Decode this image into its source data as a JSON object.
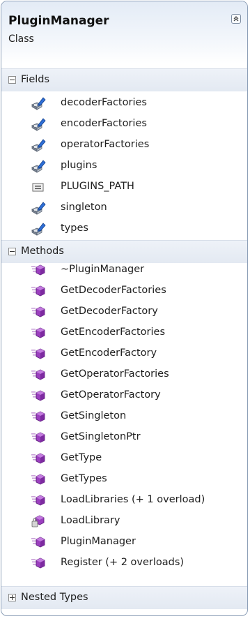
{
  "class": {
    "name": "PluginManager",
    "stereotype": "Class"
  },
  "sections": {
    "fields": {
      "label": "Fields",
      "items": [
        {
          "name": "decoderFactories",
          "icon": "field-icon"
        },
        {
          "name": "encoderFactories",
          "icon": "field-icon"
        },
        {
          "name": "operatorFactories",
          "icon": "field-icon"
        },
        {
          "name": "plugins",
          "icon": "field-icon"
        },
        {
          "name": "PLUGINS_PATH",
          "icon": "constant-icon"
        },
        {
          "name": "singleton",
          "icon": "field-icon"
        },
        {
          "name": "types",
          "icon": "field-icon"
        }
      ]
    },
    "methods": {
      "label": "Methods",
      "items": [
        {
          "name": "~PluginManager",
          "icon": "method-icon"
        },
        {
          "name": "GetDecoderFactories",
          "icon": "method-icon"
        },
        {
          "name": "GetDecoderFactory",
          "icon": "method-icon"
        },
        {
          "name": "GetEncoderFactories",
          "icon": "method-icon"
        },
        {
          "name": "GetEncoderFactory",
          "icon": "method-icon"
        },
        {
          "name": "GetOperatorFactories",
          "icon": "method-icon"
        },
        {
          "name": "GetOperatorFactory",
          "icon": "method-icon"
        },
        {
          "name": "GetSingleton",
          "icon": "method-icon"
        },
        {
          "name": "GetSingletonPtr",
          "icon": "method-icon"
        },
        {
          "name": "GetType",
          "icon": "method-icon"
        },
        {
          "name": "GetTypes",
          "icon": "method-icon"
        },
        {
          "name": "LoadLibraries (+ 1 overload)",
          "icon": "method-icon"
        },
        {
          "name": "LoadLibrary",
          "icon": "private-method-icon"
        },
        {
          "name": "PluginManager",
          "icon": "method-icon"
        },
        {
          "name": "Register (+ 2 overloads)",
          "icon": "method-icon"
        }
      ]
    },
    "nested": {
      "label": "Nested Types"
    }
  },
  "colors": {
    "border": "#8ea0b8",
    "header_gradient_top": "#e3ebf6",
    "field_icon_blue": "#2f6fd6",
    "method_icon_purple": "#9b3fbf"
  }
}
